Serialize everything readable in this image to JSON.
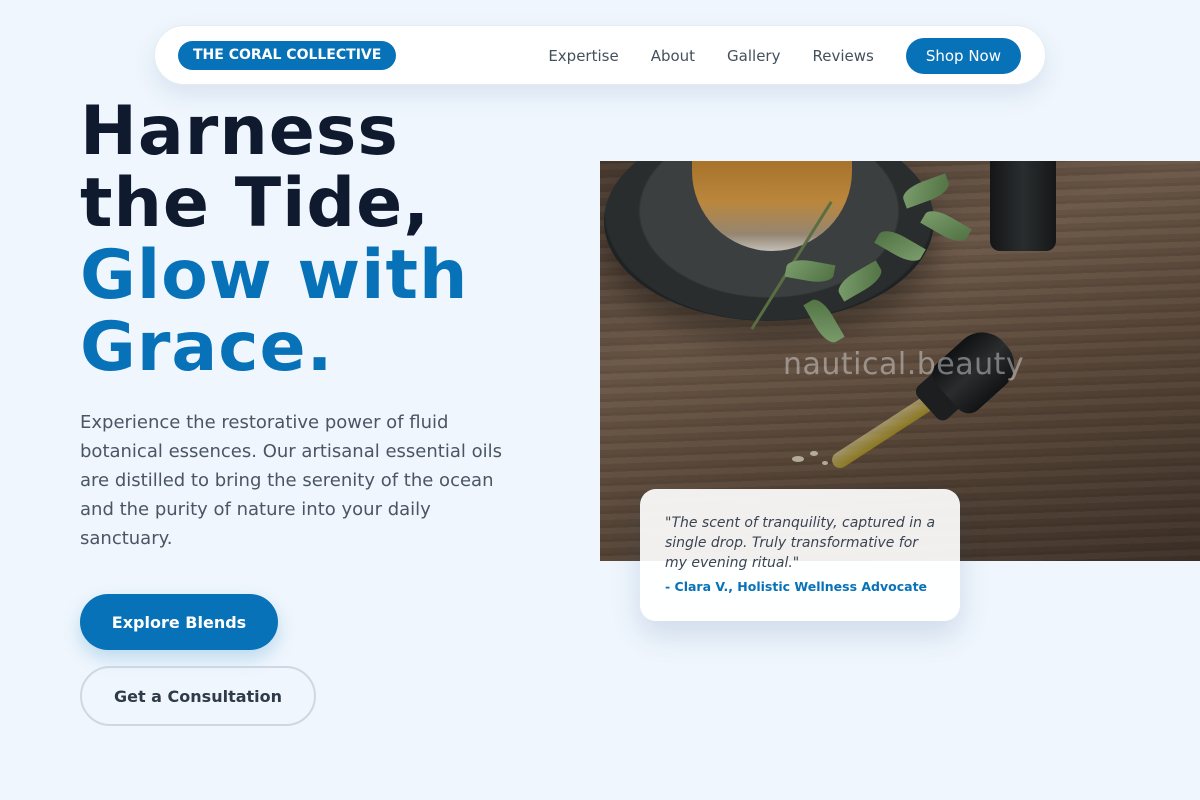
{
  "brand": {
    "name": "THE CORAL COLLECTIVE"
  },
  "nav": {
    "links": [
      "Expertise",
      "About",
      "Gallery",
      "Reviews"
    ],
    "cta": "Shop Now"
  },
  "hero": {
    "headline_dark_1": "Harness",
    "headline_dark_2": "the Tide,",
    "headline_blue_1": "Glow with",
    "headline_blue_2": "Grace.",
    "lead": "Experience the restorative power of fluid botanical essences. Our artisanal essential oils are distilled to bring the serenity of the ocean and the purity of nature into your daily sanctuary.",
    "primary_cta": "Explore Blends",
    "secondary_cta": "Get a Consultation"
  },
  "image": {
    "watermark": "nautical.beauty"
  },
  "testimonial": {
    "quote": "\"The scent of tranquility, captured in a single drop. Truly transformative for my evening ritual.\"",
    "author": "- Clara V., Holistic Wellness Advocate"
  },
  "colors": {
    "accent": "#0872b8",
    "dark_text": "#0f1a2e",
    "background": "#eff6fd"
  }
}
